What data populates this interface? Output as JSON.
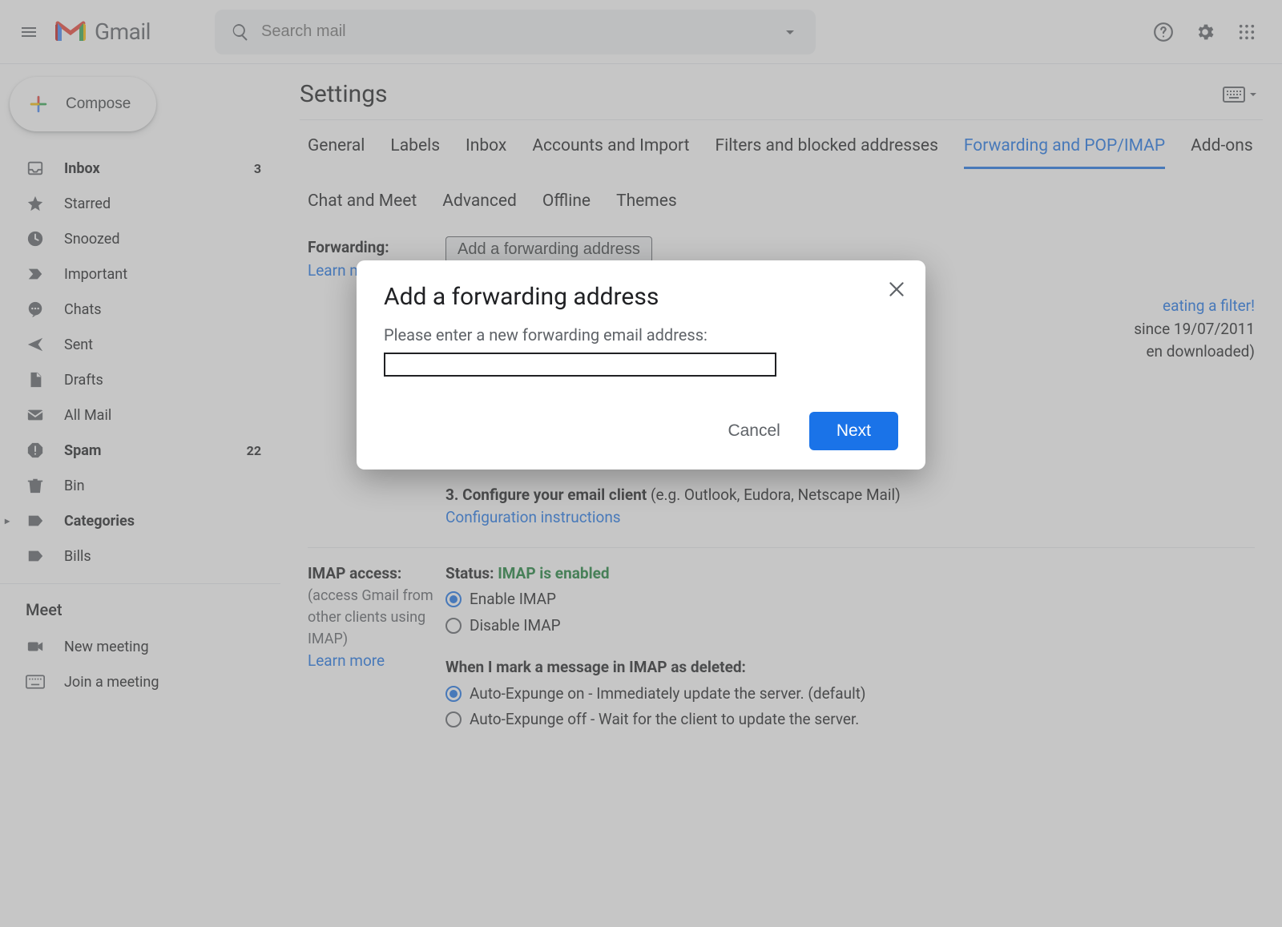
{
  "header": {
    "product_name": "Gmail",
    "search_placeholder": "Search mail"
  },
  "sidebar": {
    "compose_label": "Compose",
    "items": [
      {
        "icon": "inbox",
        "label": "Inbox",
        "count": "3",
        "bold": true
      },
      {
        "icon": "star",
        "label": "Starred",
        "count": "",
        "bold": false
      },
      {
        "icon": "clock",
        "label": "Snoozed",
        "count": "",
        "bold": false
      },
      {
        "icon": "important",
        "label": "Important",
        "count": "",
        "bold": false
      },
      {
        "icon": "chat",
        "label": "Chats",
        "count": "",
        "bold": false
      },
      {
        "icon": "send",
        "label": "Sent",
        "count": "",
        "bold": false
      },
      {
        "icon": "draft",
        "label": "Drafts",
        "count": "",
        "bold": false
      },
      {
        "icon": "allmail",
        "label": "All Mail",
        "count": "",
        "bold": false
      },
      {
        "icon": "spam",
        "label": "Spam",
        "count": "22",
        "bold": true
      },
      {
        "icon": "trash",
        "label": "Bin",
        "count": "",
        "bold": false
      },
      {
        "icon": "label",
        "label": "Categories",
        "count": "",
        "bold": true,
        "expandable": true
      },
      {
        "icon": "label",
        "label": "Bills",
        "count": "",
        "bold": false
      }
    ],
    "meet_header": "Meet",
    "meet_items": [
      {
        "icon": "video",
        "label": "New meeting"
      },
      {
        "icon": "keyboard",
        "label": "Join a meeting"
      }
    ]
  },
  "main": {
    "page_title": "Settings",
    "tabs": [
      "General",
      "Labels",
      "Inbox",
      "Accounts and Import",
      "Filters and blocked addresses",
      "Forwarding and POP/IMAP",
      "Add-ons",
      "Chat and Meet",
      "Advanced",
      "Offline",
      "Themes"
    ],
    "active_tab_index": 5,
    "forwarding": {
      "title": "Forwarding:",
      "learn_more": "Learn more",
      "button_label": "Add a forwarding address",
      "tip_suffix": "eating a filter!"
    },
    "pop": {
      "status_line_1": "since 19/07/2011",
      "status_line_2": "en downloaded)",
      "step3_bold": "3. Configure your email client",
      "step3_rest": " (e.g. Outlook, Eudora, Netscape Mail)",
      "config_link": "Configuration instructions"
    },
    "imap": {
      "title": "IMAP access:",
      "subtitle": "(access Gmail from other clients using IMAP)",
      "learn_more": "Learn more",
      "status_label": "Status: ",
      "status_value": "IMAP is enabled",
      "opt_enable": "Enable IMAP",
      "opt_disable": "Disable IMAP",
      "deleted_header": "When I mark a message in IMAP as deleted:",
      "opt_expunge_on": "Auto-Expunge on - Immediately update the server. (default)",
      "opt_expunge_off": "Auto-Expunge off - Wait for the client to update the server."
    }
  },
  "dialog": {
    "title": "Add a forwarding address",
    "subtitle": "Please enter a new forwarding email address:",
    "input_value": "",
    "cancel_label": "Cancel",
    "next_label": "Next"
  }
}
